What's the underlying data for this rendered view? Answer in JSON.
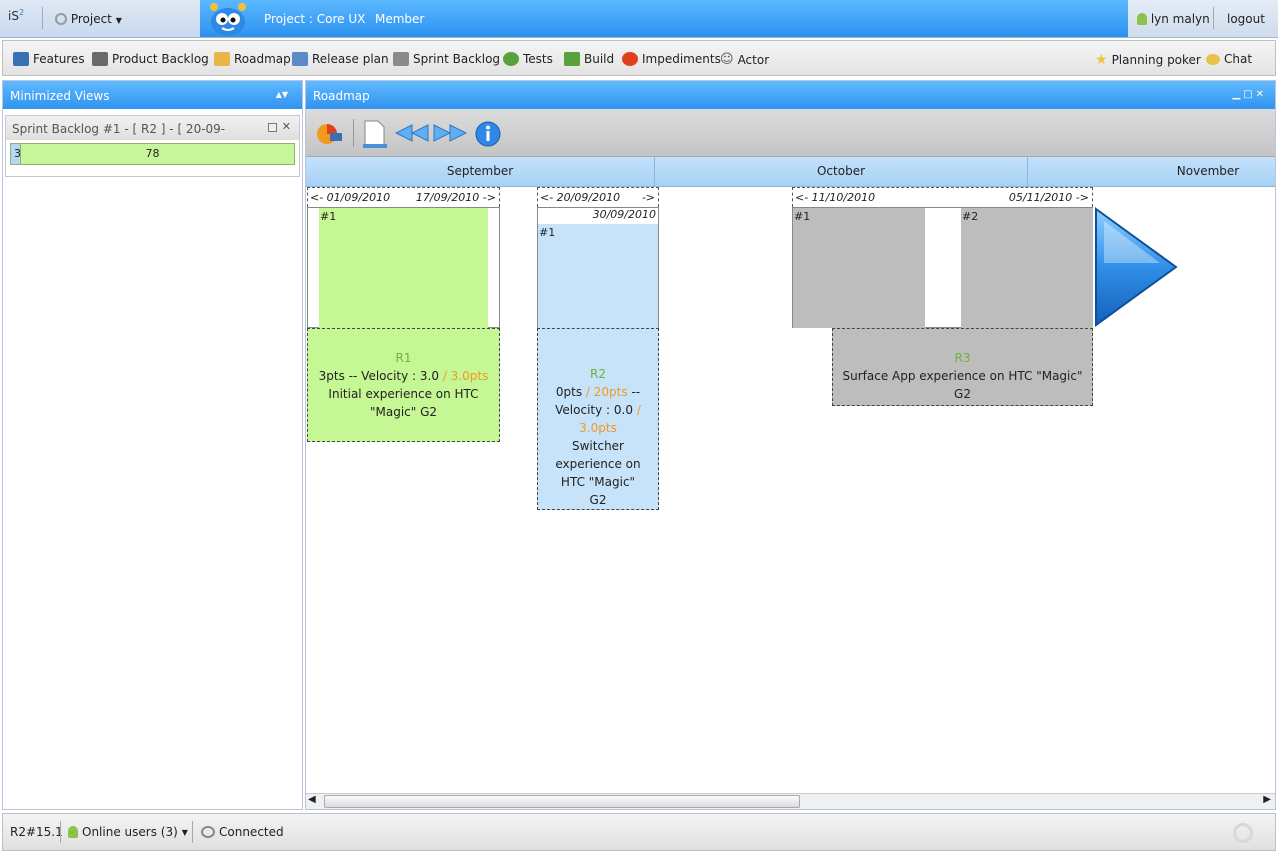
{
  "header": {
    "logo": "iS",
    "logo_sup": "2",
    "project_menu": "Project",
    "project_title": "Project : Core UX",
    "project_role": "Member",
    "username": "lyn malyn",
    "logout": "logout"
  },
  "nav": {
    "items": [
      {
        "label": "Features",
        "icon": "features-icon",
        "color": "#3a6fb5"
      },
      {
        "label": "Product Backlog",
        "icon": "backlog-icon",
        "color": "#6a6a6a"
      },
      {
        "label": "Roadmap",
        "icon": "folder-icon",
        "color": "#e8b547"
      },
      {
        "label": "Release plan",
        "icon": "release-plan-icon",
        "color": "#5a8ac8"
      },
      {
        "label": "Sprint Backlog",
        "icon": "sprint-backlog-icon",
        "color": "#8a8a8a"
      },
      {
        "label": "Tests",
        "icon": "tests-icon",
        "color": "#59a13a"
      },
      {
        "label": "Build",
        "icon": "build-icon",
        "color": "#59a13a"
      },
      {
        "label": "Impediments",
        "icon": "impediment-icon",
        "color": "#e2401c"
      },
      {
        "label": "Actor",
        "icon": "actor-icon",
        "color": "#555555"
      }
    ],
    "planning_poker": "Planning poker",
    "chat": "Chat"
  },
  "left_panel": {
    "title": "Minimized Views",
    "widget_title": "Sprint Backlog #1 - [ R2 ] - [ 20-09-",
    "done_count": "3",
    "todo_count": "78",
    "done_fraction": 0.037
  },
  "main_panel": {
    "title": "Roadmap",
    "months": [
      "September",
      "October",
      "November"
    ]
  },
  "releases": [
    {
      "start": "<- 01/09/2010",
      "end": "17/09/2010 ->",
      "sprint_tags": [
        "#1"
      ],
      "name": "R1",
      "points": "3pts",
      "velocity_label": "-- Velocity : 3.0",
      "capacity": "/ 3.0pts",
      "description": "Initial experience on HTC \"Magic\" G2",
      "color": "#c5f794"
    },
    {
      "start": "<- 20/09/2010",
      "end": "->",
      "sprint_end": "30/09/2010",
      "sprint_tags": [
        "#1"
      ],
      "name": "R2",
      "points": "0pts",
      "capacity_pts": "/ 20pts",
      "velocity_label": "--",
      "velocity": "Velocity : 0.0",
      "capacity": "/ 3.0pts",
      "description": "Switcher experience on HTC \"Magic\" G2",
      "color": "#c6e3fa"
    },
    {
      "start": "<- 11/10/2010",
      "end": "05/11/2010 ->",
      "sprint_tags": [
        "#1",
        "#2"
      ],
      "name": "R3",
      "description": "Surface App experience on HTC \"Magic\" G2",
      "color": "#bdbdbd"
    }
  ],
  "status": {
    "version": "R2#15.1",
    "online_users": "Online users (3)",
    "connection": "Connected"
  }
}
